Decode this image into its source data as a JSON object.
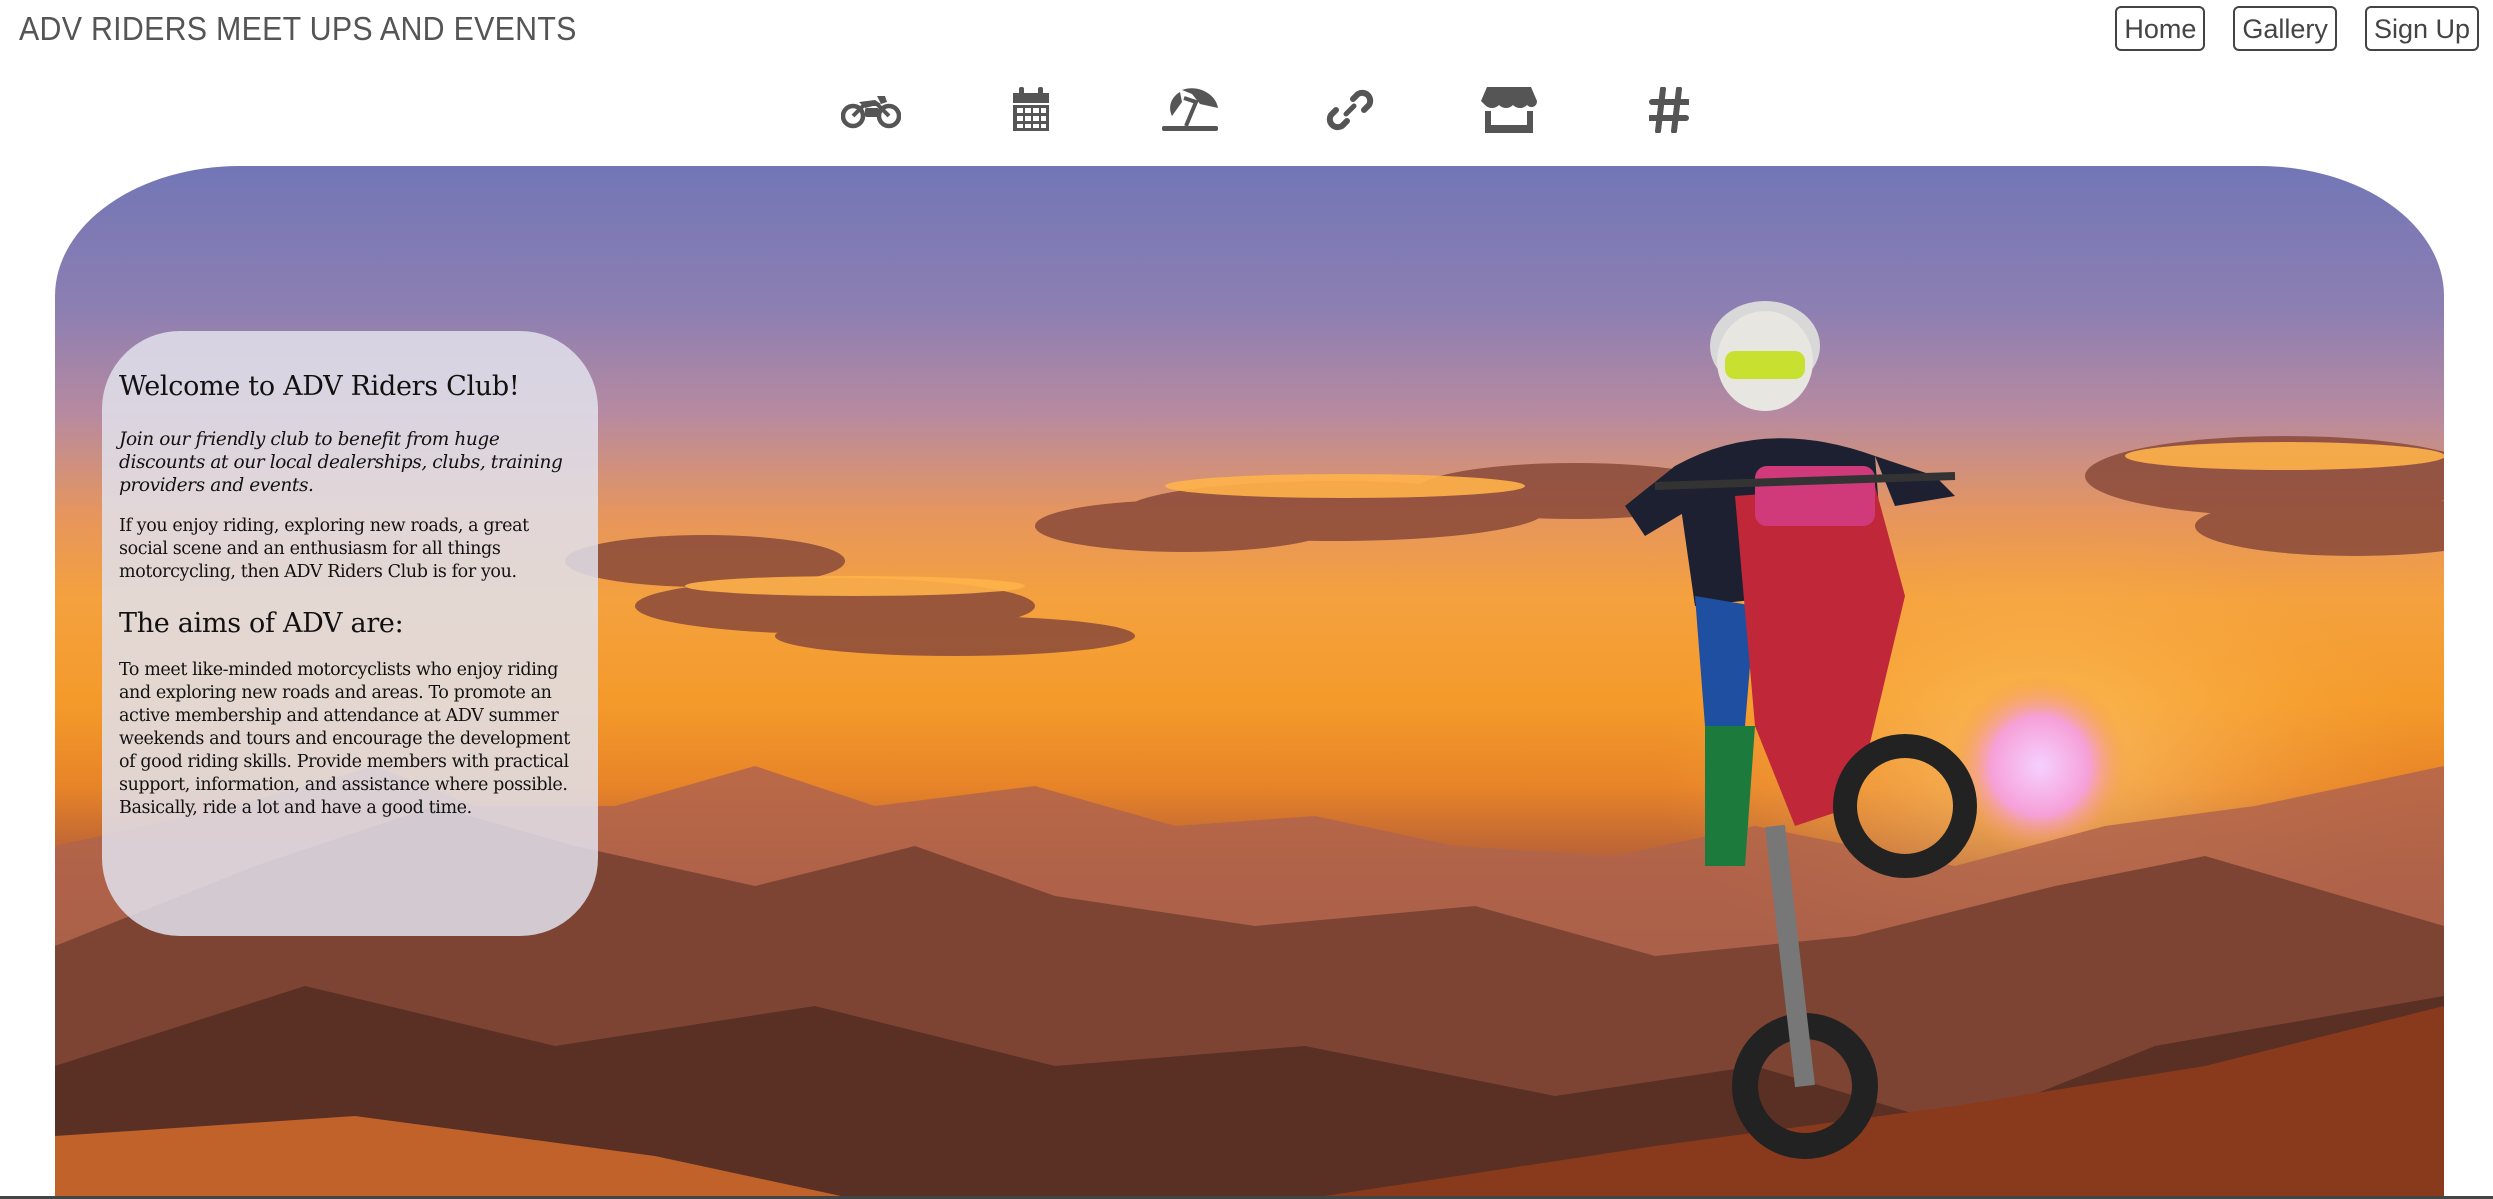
{
  "header": {
    "site_title": "ADV RIDERS MEET UPS AND EVENTS",
    "nav": [
      {
        "label": "Home"
      },
      {
        "label": "Gallery"
      },
      {
        "label": "Sign Up"
      }
    ]
  },
  "icon_bar": [
    {
      "icon": "motorcycle-icon"
    },
    {
      "icon": "calendar-icon"
    },
    {
      "icon": "beach-umbrella-icon"
    },
    {
      "icon": "link-icon"
    },
    {
      "icon": "store-icon"
    },
    {
      "icon": "hashtag-icon"
    }
  ],
  "welcome": {
    "title": "Welcome to ADV Riders Club!",
    "lead": "Join our friendly club to benefit from huge discounts at our local dealerships, clubs, training providers and events.",
    "intro": "If you enjoy riding, exploring new roads, a great social scene and an enthusiasm for all things motorcycling, then ADV Riders Club is for you.",
    "aims_title": "The aims of ADV are:",
    "aims_text": "To meet like-minded motorcyclists who enjoy riding and exploring new roads and areas. To promote an active membership and attendance at ADV summer weekends and tours and encourage the development of good riding skills. Provide members with practical support, information, and assistance where possible. Basically, ride a lot and have a good time."
  },
  "colors": {
    "nav_border": "#444444",
    "icon": "#555555",
    "panel_bg": "rgba(225,225,235,0.86)"
  }
}
